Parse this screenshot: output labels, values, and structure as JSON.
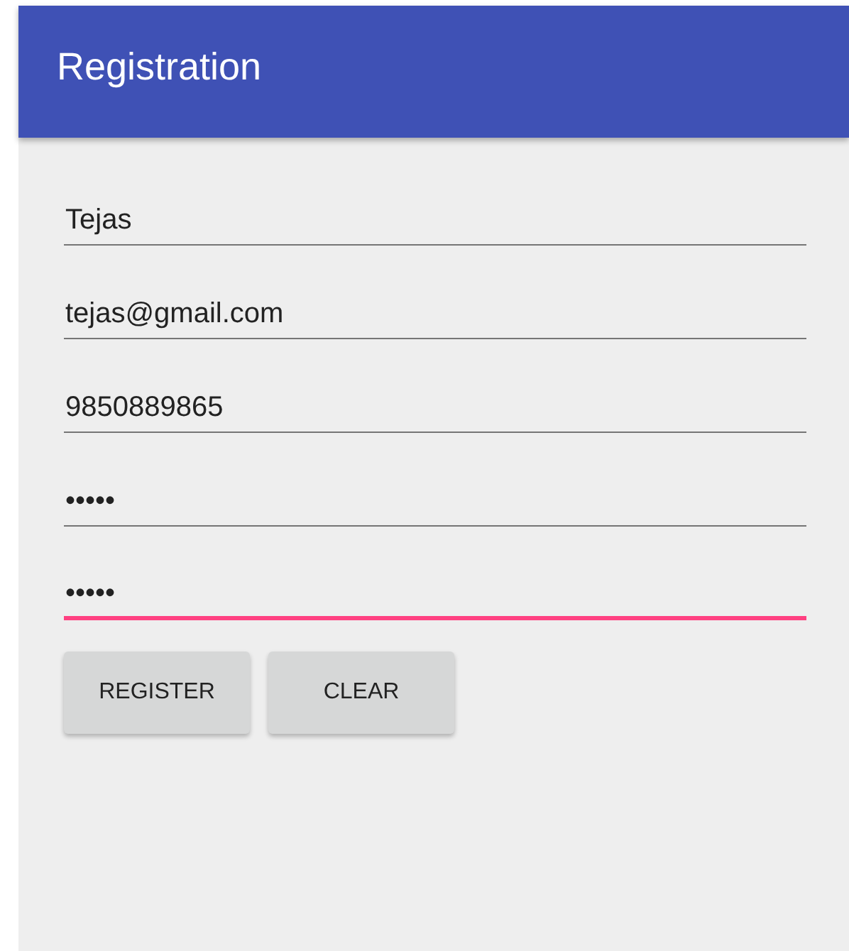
{
  "app_bar": {
    "title": "Registration"
  },
  "fields": [
    {
      "value": "Tejas",
      "focused": false
    },
    {
      "value": "tejas@gmail.com",
      "focused": false
    },
    {
      "value": "9850889865",
      "focused": false
    },
    {
      "value": "•••••",
      "focused": false
    },
    {
      "value": "•••••",
      "focused": true
    }
  ],
  "buttons": [
    "REGISTER",
    "CLEAR"
  ]
}
